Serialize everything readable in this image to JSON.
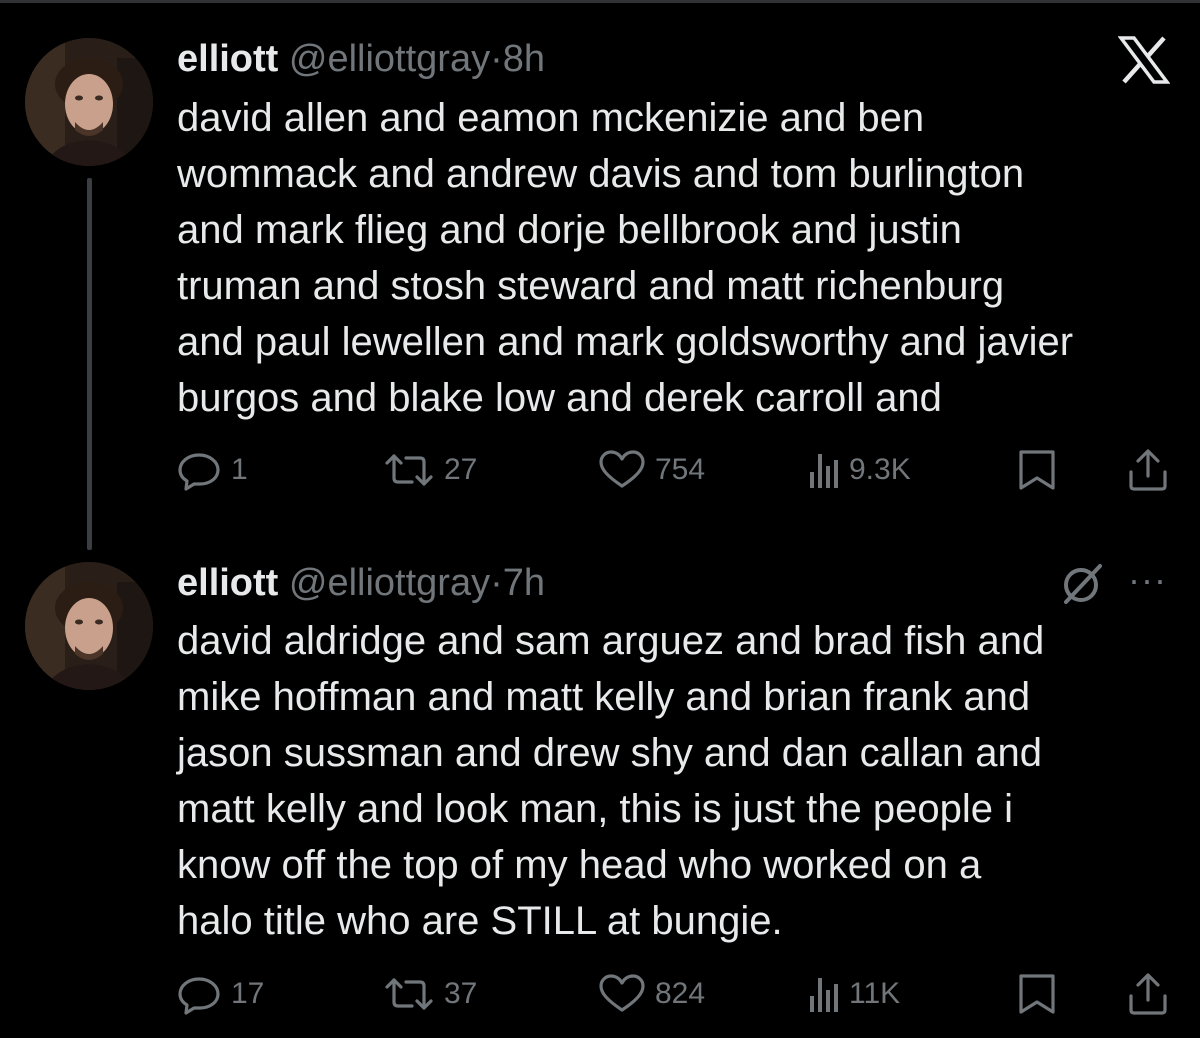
{
  "tweets": [
    {
      "name": "elliott",
      "handle": "@elliottgray",
      "separator": "·",
      "time": "8h",
      "lines": [
        "david allen and eamon mckenizie and ben",
        "wommack and andrew davis and tom burlington",
        "and mark flieg and dorje bellbrook and justin",
        "truman and stosh steward and matt richenburg",
        "and paul lewellen and mark goldsworthy and javier",
        "burgos and blake low and derek carroll and"
      ],
      "replies": "1",
      "reposts": "27",
      "likes": "754",
      "views": "9.3K"
    },
    {
      "name": "elliott",
      "handle": "@elliottgray",
      "separator": "·",
      "time": "7h",
      "lines": [
        "david aldridge and sam arguez and brad fish and",
        "mike hoffman and matt kelly and brian frank and",
        "jason sussman and drew shy and dan callan and",
        "matt kelly and look man, this is just the people i",
        "know off the top of my head who worked on a",
        "halo title who are STILL at bungie."
      ],
      "replies": "17",
      "reposts": "37",
      "likes": "824",
      "views": "11K"
    }
  ],
  "icons": {
    "close": "x-logo-icon",
    "grok": "grok-icon",
    "more": "more-icon",
    "more_glyph": "···"
  },
  "colors": {
    "background": "#000000",
    "text": "#e7e9ea",
    "muted": "#71767b",
    "thread_line": "#3a3d41"
  }
}
